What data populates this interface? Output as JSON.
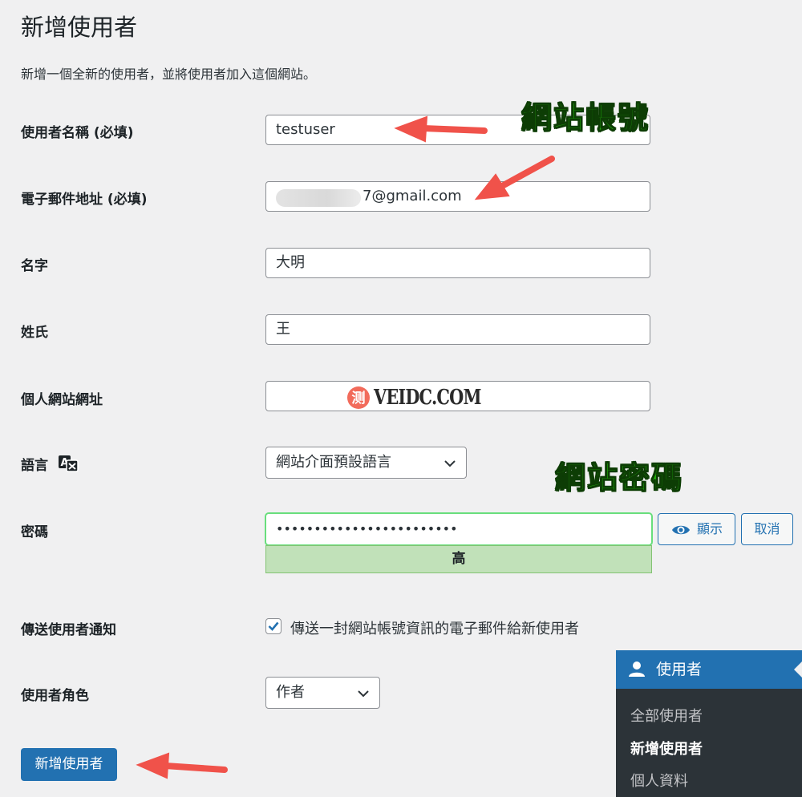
{
  "page": {
    "title": "新增使用者",
    "description": "新增一個全新的使用者，並將使用者加入這個網站。"
  },
  "form": {
    "username": {
      "label": "使用者名稱 (必填)",
      "value": "testuser"
    },
    "email": {
      "label": "電子郵件地址 (必填)",
      "value_visible": "7@gmail.com"
    },
    "first_name": {
      "label": "名字",
      "value": "大明"
    },
    "last_name": {
      "label": "姓氏",
      "value": "王"
    },
    "website": {
      "label": "個人網站網址",
      "value": ""
    },
    "language": {
      "label": "語言",
      "selected": "網站介面預設語言",
      "icon": "translation-icon"
    },
    "password": {
      "label": "密碼",
      "masked": "••••••••••••••••••••••••",
      "strength": "高",
      "show_button": "顯示",
      "cancel_button": "取消",
      "show_icon": "eye-icon"
    },
    "notify": {
      "label": "傳送使用者通知",
      "checked": true,
      "text": "傳送一封網站帳號資訊的電子郵件給新使用者"
    },
    "role": {
      "label": "使用者角色",
      "selected": "作者"
    },
    "submit_label": "新增使用者"
  },
  "annotations": {
    "account": "網站帳號",
    "password": "網站密碼"
  },
  "watermark": {
    "badge": "测",
    "text": "VEIDC.COM"
  },
  "admin_menu": {
    "heading": "使用者",
    "heading_icon": "user-icon",
    "items": [
      {
        "label": "全部使用者",
        "active": false
      },
      {
        "label": "新增使用者",
        "active": true
      },
      {
        "label": "個人資料",
        "active": false
      }
    ]
  },
  "colors": {
    "primary": "#2271b1",
    "strength_bg": "#c1e1b9",
    "annotation_green": "#22c40a",
    "arrow_red": "#f0524a",
    "menu_bg": "#2c3338"
  }
}
